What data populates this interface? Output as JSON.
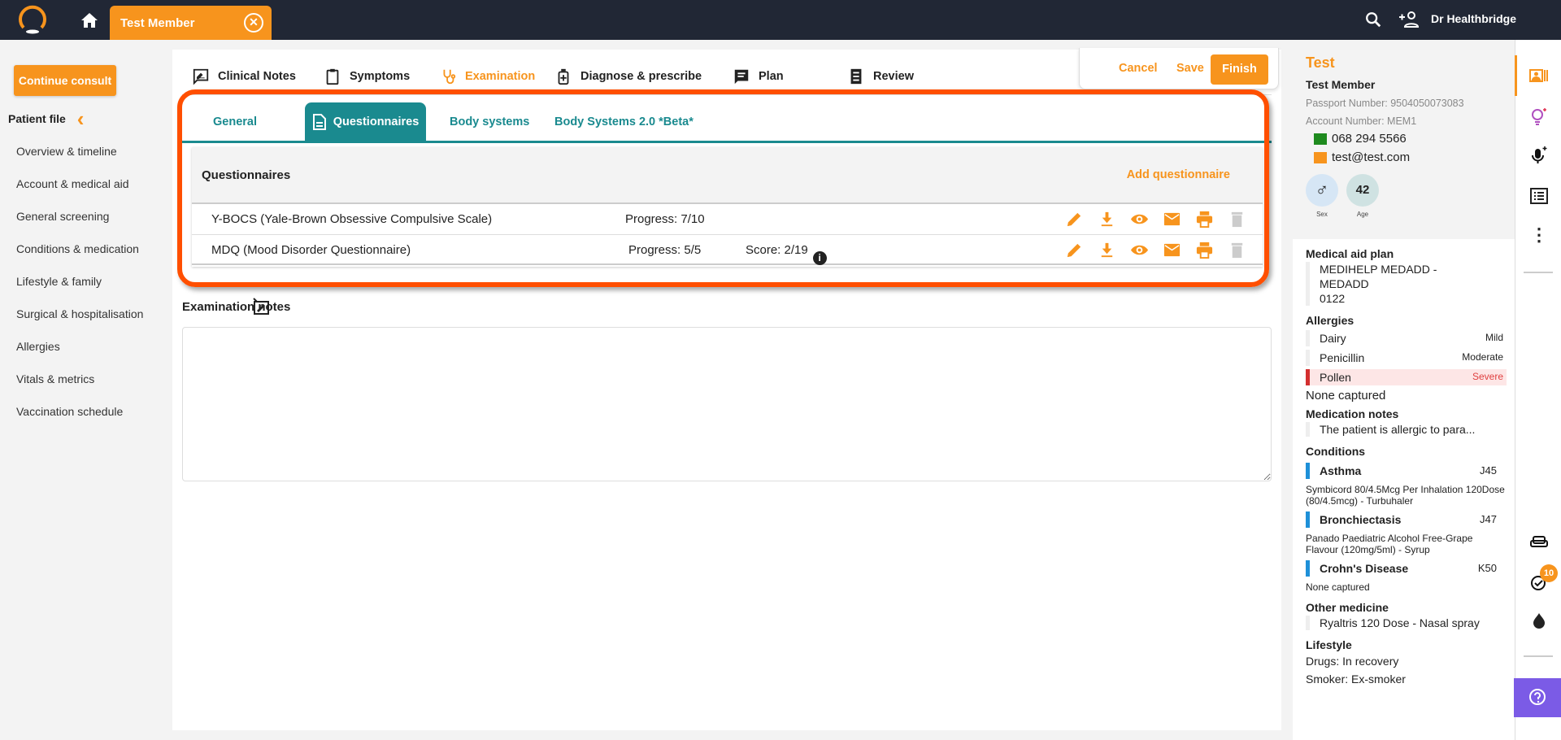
{
  "topbar": {
    "patient_tab": "Test Member",
    "user": "Dr Healthbridge"
  },
  "sidebar": {
    "continue": "Continue consult",
    "patient_file": "Patient file",
    "items": [
      "Overview & timeline",
      "Account & medical aid",
      "General screening",
      "Conditions & medication",
      "Lifestyle & family",
      "Surgical & hospitalisation",
      "Allergies",
      "Vitals & metrics",
      "Vaccination schedule"
    ]
  },
  "steps": [
    "Clinical Notes",
    "Symptoms",
    "Examination",
    "Diagnose & prescribe",
    "Plan",
    "Review"
  ],
  "actions": {
    "cancel": "Cancel",
    "save": "Save",
    "finish": "Finish"
  },
  "subtabs": [
    "General",
    "Questionnaires",
    "Body systems",
    "Body Systems 2.0 *Beta*"
  ],
  "questionnaires": {
    "title": "Questionnaires",
    "add": "Add questionnaire",
    "rows": [
      {
        "name": "Y-BOCS (Yale-Brown Obsessive Compulsive Scale)",
        "progress": "Progress: 7/10"
      },
      {
        "name": "MDQ (Mood Disorder Questionnaire)",
        "progress": "Progress: 5/5",
        "score": "Score: 2/19"
      }
    ]
  },
  "notes": {
    "label": "Examination notes",
    "value": ""
  },
  "patient": {
    "first": "Test",
    "full": "Test Member",
    "passport": "Passport Number: 9504050073083",
    "account": "Account Number: MEM1",
    "phone": "068 294 5566",
    "email": "test@test.com",
    "age": "42",
    "sex_label": "Sex",
    "age_label": "Age",
    "medical_aid_title": "Medical aid plan",
    "medical_aid": [
      "MEDIHELP MEDADD -",
      "MEDADD",
      "0122"
    ],
    "allergies_title": "Allergies",
    "allergies": [
      {
        "name": "Dairy",
        "sev": "Mild"
      },
      {
        "name": "Penicillin",
        "sev": "Moderate"
      },
      {
        "name": "Pollen",
        "sev": "Severe"
      }
    ],
    "allergies_none": "None captured",
    "med_notes_title": "Medication notes",
    "med_notes": "The patient is allergic to para...",
    "conditions_title": "Conditions",
    "conditions": [
      {
        "name": "Asthma",
        "code": "J45",
        "med": "Symbicord 80/4.5Mcg Per Inhalation 120Dose (80/4.5mcg) - Turbuhaler"
      },
      {
        "name": "Bronchiectasis",
        "code": "J47",
        "med": "Panado Paediatric Alcohol Free-Grape Flavour (120mg/5ml) - Syrup"
      },
      {
        "name": "Crohn's Disease",
        "code": "K50",
        "med": "None captured"
      }
    ],
    "other_title": "Other medicine",
    "other": "Ryaltris 120 Dose - Nasal spray",
    "lifestyle_title": "Lifestyle",
    "drugs": "Drugs: In recovery",
    "smoker": "Smoker: Ex-smoker"
  },
  "rail": {
    "tasks_badge": "10"
  },
  "colors": {
    "accent": "#f7941d",
    "teal": "#1a8a8f",
    "highlight": "#ff4f00",
    "topbar": "#212735"
  }
}
